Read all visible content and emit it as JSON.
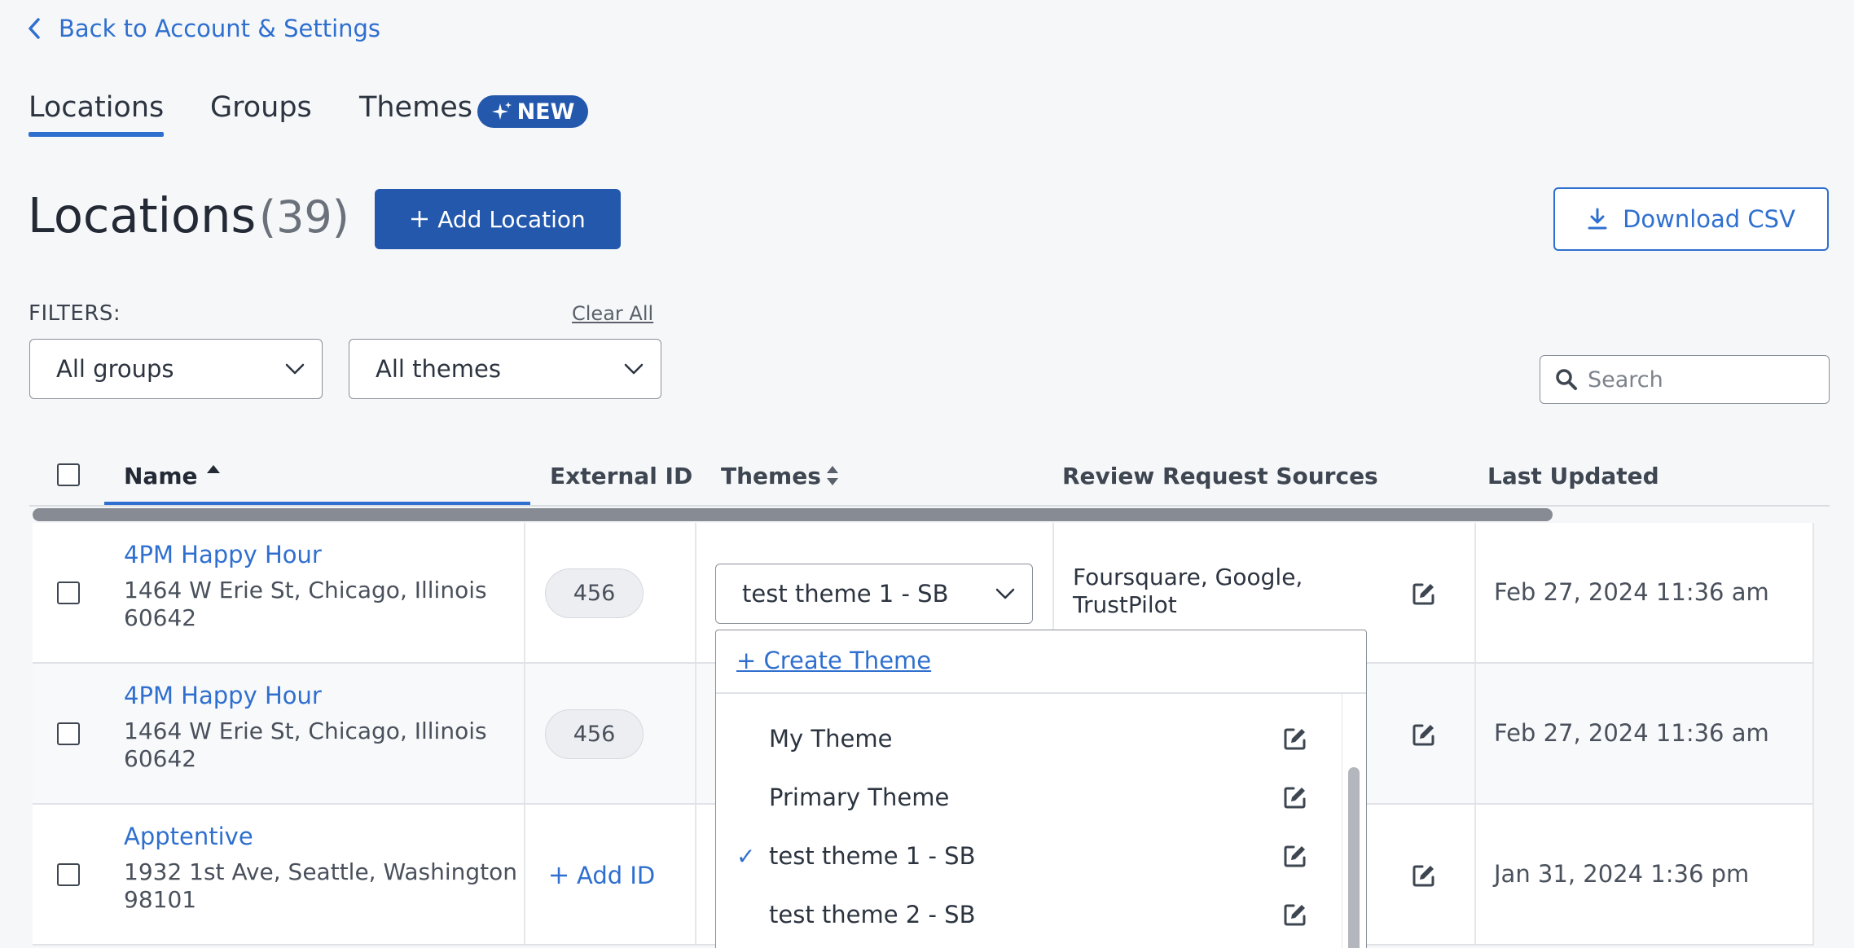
{
  "back_link": {
    "label": "Back to Account & Settings"
  },
  "tabs": [
    {
      "label": "Locations",
      "active": true
    },
    {
      "label": "Groups"
    },
    {
      "label": "Themes",
      "badge": "NEW"
    }
  ],
  "page": {
    "title": "Locations",
    "count": "(39)",
    "add_button": "Add Location",
    "download_button": "Download CSV"
  },
  "filters": {
    "label": "FILTERS:",
    "clear_all": "Clear All",
    "groups_value": "All groups",
    "themes_value": "All themes"
  },
  "search": {
    "placeholder": "Search"
  },
  "table": {
    "columns": [
      "Name",
      "External ID",
      "Themes",
      "Review Request Sources",
      "Last Updated"
    ],
    "rows": [
      {
        "name": "4PM Happy Hour",
        "address": "1464 W Erie St, Chicago, Illinois 60642",
        "external_id": "456",
        "theme": "test theme 1 - SB",
        "sources": "Foursquare, Google, TrustPilot",
        "last_updated": "Feb 27, 2024 11:36 am"
      },
      {
        "name": "4PM Happy Hour",
        "address": "1464 W Erie St, Chicago, Illinois 60642",
        "external_id": "456",
        "last_updated": "Feb 27, 2024 11:36 am"
      },
      {
        "name": "Apptentive",
        "address": "1932 1st Ave, Seattle, Washington 98101",
        "add_id_label": "Add ID",
        "last_updated": "Jan 31, 2024 1:36 pm"
      }
    ]
  },
  "theme_menu": {
    "create_label": "+ Create Theme",
    "items": [
      {
        "label": "My Theme",
        "selected": false
      },
      {
        "label": "Primary Theme",
        "selected": false
      },
      {
        "label": "test theme 1 - SB",
        "selected": true
      },
      {
        "label": "test theme 2 - SB",
        "selected": false
      }
    ]
  },
  "colors": {
    "accent": "#2f6fcf",
    "primary_button": "#2358ad",
    "background": "#f6f7f9"
  }
}
